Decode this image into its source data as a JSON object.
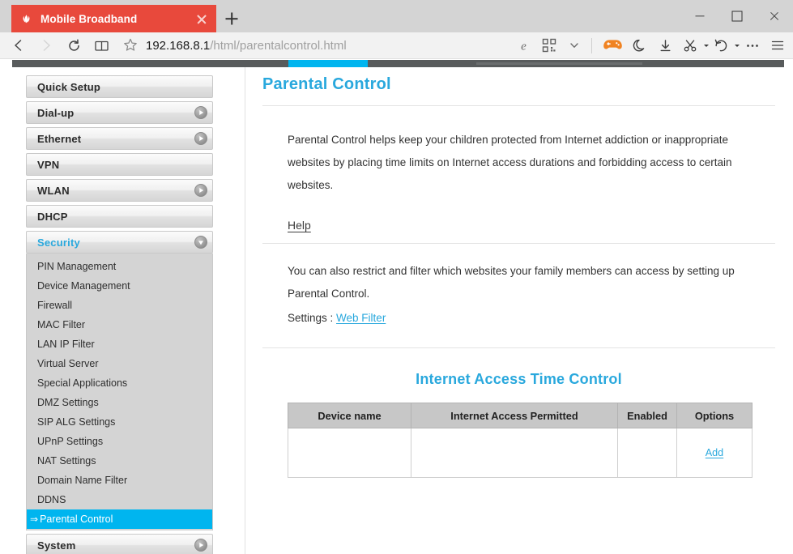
{
  "browser": {
    "tab": {
      "title": "Mobile Broadband",
      "favicon": "huawei-logo-icon",
      "close_label": "×"
    },
    "new_tab_label": "+",
    "window_controls": {
      "minimize": "–",
      "maximize": "□",
      "close": "×"
    },
    "nav": {
      "back": "back-arrow",
      "forward": "forward-arrow",
      "refresh": "refresh-arrow",
      "reading_view": "book-icon"
    },
    "address": {
      "favorite": "star-icon",
      "host": "192.168.8.1",
      "path": "/html/parentalcontrol.html"
    },
    "toolbar_icons": [
      "internet-explorer-icon",
      "qr-code-icon",
      "chevron-down-icon",
      "gamepad-icon",
      "moon-icon",
      "download-icon",
      "scissors-icon",
      "undo-icon",
      "ellipsis-icon",
      "hamburger-menu-icon"
    ]
  },
  "router": {
    "navbar": {
      "active_tab_color": "#00b5ef",
      "bar_color": "#585b5c"
    },
    "sidebar": {
      "items": [
        {
          "label": "Quick Setup",
          "arrow": "none",
          "state": "collapsed"
        },
        {
          "label": "Dial-up",
          "arrow": "right",
          "state": "collapsed"
        },
        {
          "label": "Ethernet",
          "arrow": "right",
          "state": "collapsed"
        },
        {
          "label": "VPN",
          "arrow": "none",
          "state": "collapsed"
        },
        {
          "label": "WLAN",
          "arrow": "right",
          "state": "collapsed"
        },
        {
          "label": "DHCP",
          "arrow": "none",
          "state": "collapsed"
        },
        {
          "label": "Security",
          "arrow": "down",
          "state": "expanded"
        },
        {
          "label": "System",
          "arrow": "right",
          "state": "collapsed"
        }
      ],
      "security_submenu": [
        "PIN Management",
        "Device Management",
        "Firewall",
        "MAC Filter",
        "LAN IP Filter",
        "Virtual Server",
        "Special Applications",
        "DMZ Settings",
        "SIP ALG Settings",
        "UPnP Settings",
        "NAT Settings",
        "Domain Name Filter",
        "DDNS",
        "Parental Control"
      ],
      "selected_item": "Parental Control",
      "selected_prefix": "⇒",
      "accent_color": "#00b5ef"
    },
    "content": {
      "title": "Parental Control",
      "intro": "Parental Control helps keep your children protected from Internet addiction or inappropriate websites by placing time limits on Internet access durations and forbidding access to certain websites.",
      "help_link": "Help",
      "paragraph2": "You can also restrict and filter which websites your family members can access by setting up Parental Control.",
      "settings_label": "Settings :",
      "settings_link": "Web Filter",
      "section_title": "Internet Access Time Control",
      "table": {
        "headers": [
          "Device name",
          "Internet Access Permitted",
          "Enabled",
          "Options"
        ],
        "rows": [
          {
            "device_name": "",
            "access_permitted": "",
            "enabled": "",
            "options": "Add"
          }
        ]
      }
    }
  }
}
